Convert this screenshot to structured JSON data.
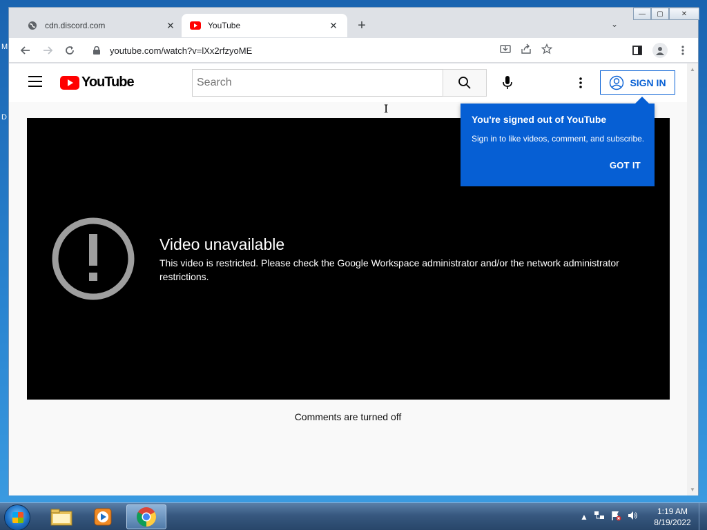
{
  "colors": {
    "youtube_red": "#ff0000",
    "youtube_blue": "#065fd4",
    "player_bg": "#000000",
    "page_bg": "#f9f9f9"
  },
  "desktop": {
    "left_letters": [
      "M",
      "D"
    ]
  },
  "browser": {
    "tabs": [
      {
        "title": "cdn.discord.com",
        "icon": "globe-icon",
        "active": false
      },
      {
        "title": "YouTube",
        "icon": "youtube-favicon",
        "active": true
      }
    ],
    "new_tab_label": "+",
    "address": "youtube.com/watch?v=lXx2rfzyoME"
  },
  "youtube": {
    "logo_text": "YouTube",
    "search_placeholder": "Search",
    "sign_in_label": "SIGN IN",
    "tooltip": {
      "title": "You're signed out of YouTube",
      "body": "Sign in to like videos, comment, and subscribe.",
      "button": "GOT IT"
    },
    "player": {
      "error_title": "Video unavailable",
      "error_message": "This video is restricted. Please check the Google Workspace administrator and/or the network administrator restrictions."
    },
    "comments_status": "Comments are turned off"
  },
  "taskbar": {
    "apps": [
      "file-explorer-icon",
      "media-player-icon",
      "chrome-icon"
    ],
    "clock_time": "1:19 AM",
    "clock_date": "8/19/2022"
  }
}
